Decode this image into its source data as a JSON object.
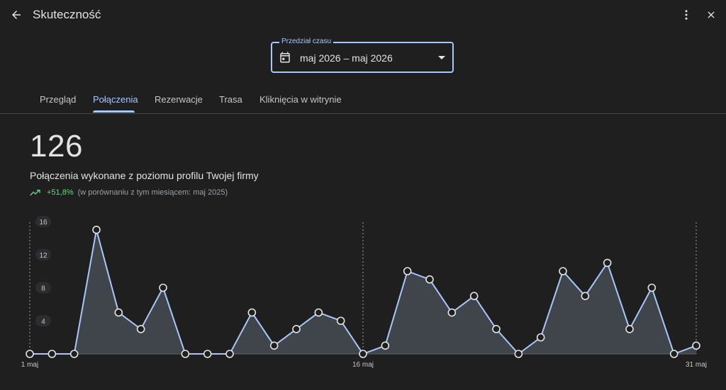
{
  "header": {
    "title": "Skuteczność",
    "back_icon": "arrow-left-icon",
    "more_icon": "more-vert-icon",
    "close_icon": "close-icon"
  },
  "date_range": {
    "label": "Przedział czasu",
    "value": "maj 2026 – maj 2026",
    "accent": "#a8c7fa"
  },
  "tabs": [
    {
      "label": "Przegląd",
      "active": false
    },
    {
      "label": "Połączenia",
      "active": true
    },
    {
      "label": "Rezerwacje",
      "active": false
    },
    {
      "label": "Trasa",
      "active": false
    },
    {
      "label": "Kliknięcia w witrynie",
      "active": false
    }
  ],
  "metric": {
    "value": "126",
    "description": "Połączenia wykonane z poziomu profilu Twojej firmy",
    "trend_percent": "+51,8%",
    "trend_comparison": "(w porównaniu z tym miesiącem: maj 2025)",
    "trend_color": "#6dd58c"
  },
  "chart_data": {
    "type": "area",
    "x": [
      1,
      2,
      3,
      4,
      5,
      6,
      7,
      8,
      9,
      10,
      11,
      12,
      13,
      14,
      15,
      16,
      17,
      18,
      19,
      20,
      21,
      22,
      23,
      24,
      25,
      26,
      27,
      28,
      29,
      30,
      31
    ],
    "values": [
      0,
      0,
      0,
      15,
      5,
      3,
      8,
      0,
      0,
      0,
      5,
      1,
      3,
      5,
      4,
      0,
      1,
      10,
      9,
      5,
      7,
      3,
      0,
      2,
      10,
      7,
      11,
      3,
      8,
      0,
      1
    ],
    "y_ticks": [
      "16",
      "12",
      "8",
      "4"
    ],
    "ylim": [
      0,
      16
    ],
    "x_tick_labels": [
      {
        "day": 1,
        "label": "1 maj"
      },
      {
        "day": 16,
        "label": "16 maj"
      },
      {
        "day": 31,
        "label": "31 maj"
      }
    ],
    "line_color": "#a8c7fa",
    "fill_color": "#474b53",
    "grid": false
  }
}
